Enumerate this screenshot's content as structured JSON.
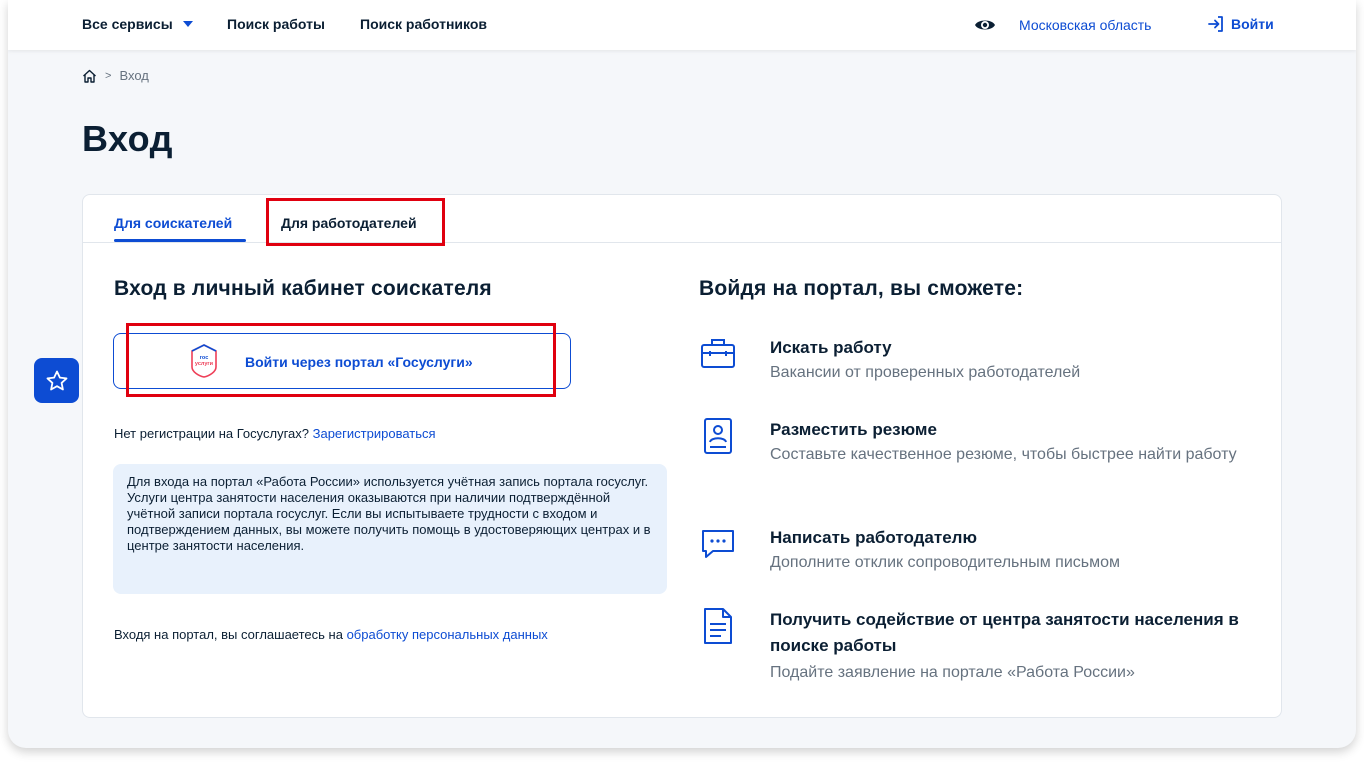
{
  "header": {
    "all_services": "Все сервисы",
    "job_search": "Поиск работы",
    "worker_search": "Поиск работников",
    "region": "Московская область",
    "login": "Войти"
  },
  "breadcrumb": {
    "current": "Вход",
    "separator": ">"
  },
  "page_title": "Вход",
  "tabs": [
    {
      "label": "Для соискателей",
      "active": true
    },
    {
      "label": "Для работодателей",
      "active": false
    }
  ],
  "login_section": {
    "heading": "Вход в личный кабинет соискателя",
    "gosuslugi_button": "Войти через портал «Госуслуги»",
    "gosuslugi_logo_text": "гос услуги",
    "no_registration": "Нет регистрации на Госуслугах?",
    "register_link": "Зарегистрироваться",
    "info_text": "Для входа на портал «Работа России» используется учётная запись портала госуслуг. Услуги центра занятости населения оказываются при наличии подтверждённой учётной записи портала госуслуг. Если вы испытываете трудности с входом и подтверждением данных, вы можете получить помощь в удостоверяющих центрах и в центре занятости населения.",
    "consent_text": "Входя на портал, вы соглашаетесь на",
    "consent_link": "обработку персональных данных"
  },
  "benefits": {
    "heading": "Войдя на портал, вы сможете:",
    "items": [
      {
        "icon": "briefcase-icon",
        "title": "Искать работу",
        "description": "Вакансии от проверенных работодателей"
      },
      {
        "icon": "resume-icon",
        "title": "Разместить резюме",
        "description": "Составьте качественное резюме, чтобы быстрее найти работу"
      },
      {
        "icon": "chat-icon",
        "title": "Написать работодателю",
        "description": "Дополните отклик сопроводительным письмом"
      },
      {
        "icon": "document-icon",
        "title": "Получить содействие от центра занятости населения в поиске работы",
        "description": "Подайте заявление на портале «Работа России»"
      }
    ]
  },
  "colors": {
    "accent": "#0d4cd3",
    "highlight": "#e0000f",
    "info_bg": "#e8f1fc",
    "muted_text": "#66727f"
  }
}
